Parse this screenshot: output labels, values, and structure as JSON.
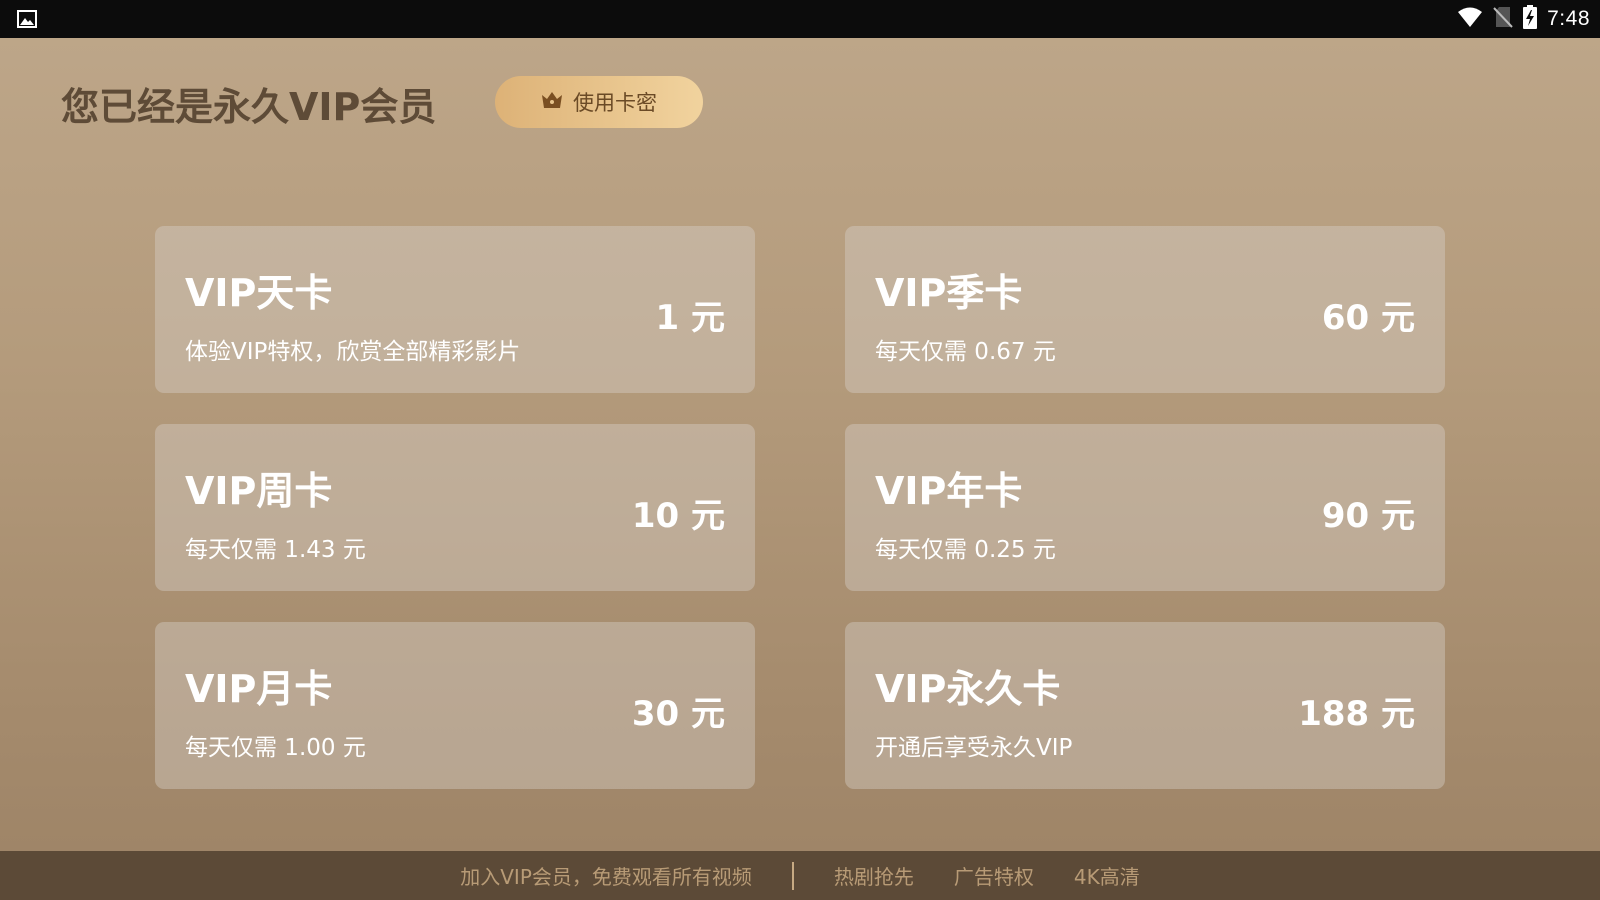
{
  "status_bar": {
    "time": "7:48",
    "icons": [
      "gallery-icon",
      "wifi-icon",
      "no-sim-icon",
      "battery-charging-icon"
    ]
  },
  "header": {
    "title": "您已经是永久VIP会员",
    "use_card_button": {
      "label": "使用卡密",
      "icon": "crown-icon"
    }
  },
  "plans": [
    {
      "name": "VIP天卡",
      "desc": "体验VIP特权，欣赏全部精彩影片",
      "price": "1 元"
    },
    {
      "name": "VIP季卡",
      "desc": "每天仅需 0.67 元",
      "price": "60 元"
    },
    {
      "name": "VIP周卡",
      "desc": "每天仅需 1.43 元",
      "price": "10 元"
    },
    {
      "name": "VIP年卡",
      "desc": "每天仅需 0.25 元",
      "price": "90 元"
    },
    {
      "name": "VIP月卡",
      "desc": "每天仅需 1.00 元",
      "price": "30 元"
    },
    {
      "name": "VIP永久卡",
      "desc": "开通后享受永久VIP",
      "price": "188 元"
    }
  ],
  "footer": {
    "slogan": "加入VIP会员，免费观看所有视频",
    "perks": [
      "热剧抢先",
      "广告特权",
      "4K高清"
    ]
  },
  "colors": {
    "status_bar": "#0c0c0c",
    "title": "#5e4b37",
    "button_gradient_start": "#ddb277",
    "button_gradient_end": "#f1d39e",
    "footer_bg": "#5c4a37",
    "footer_text": "#b89b76"
  }
}
